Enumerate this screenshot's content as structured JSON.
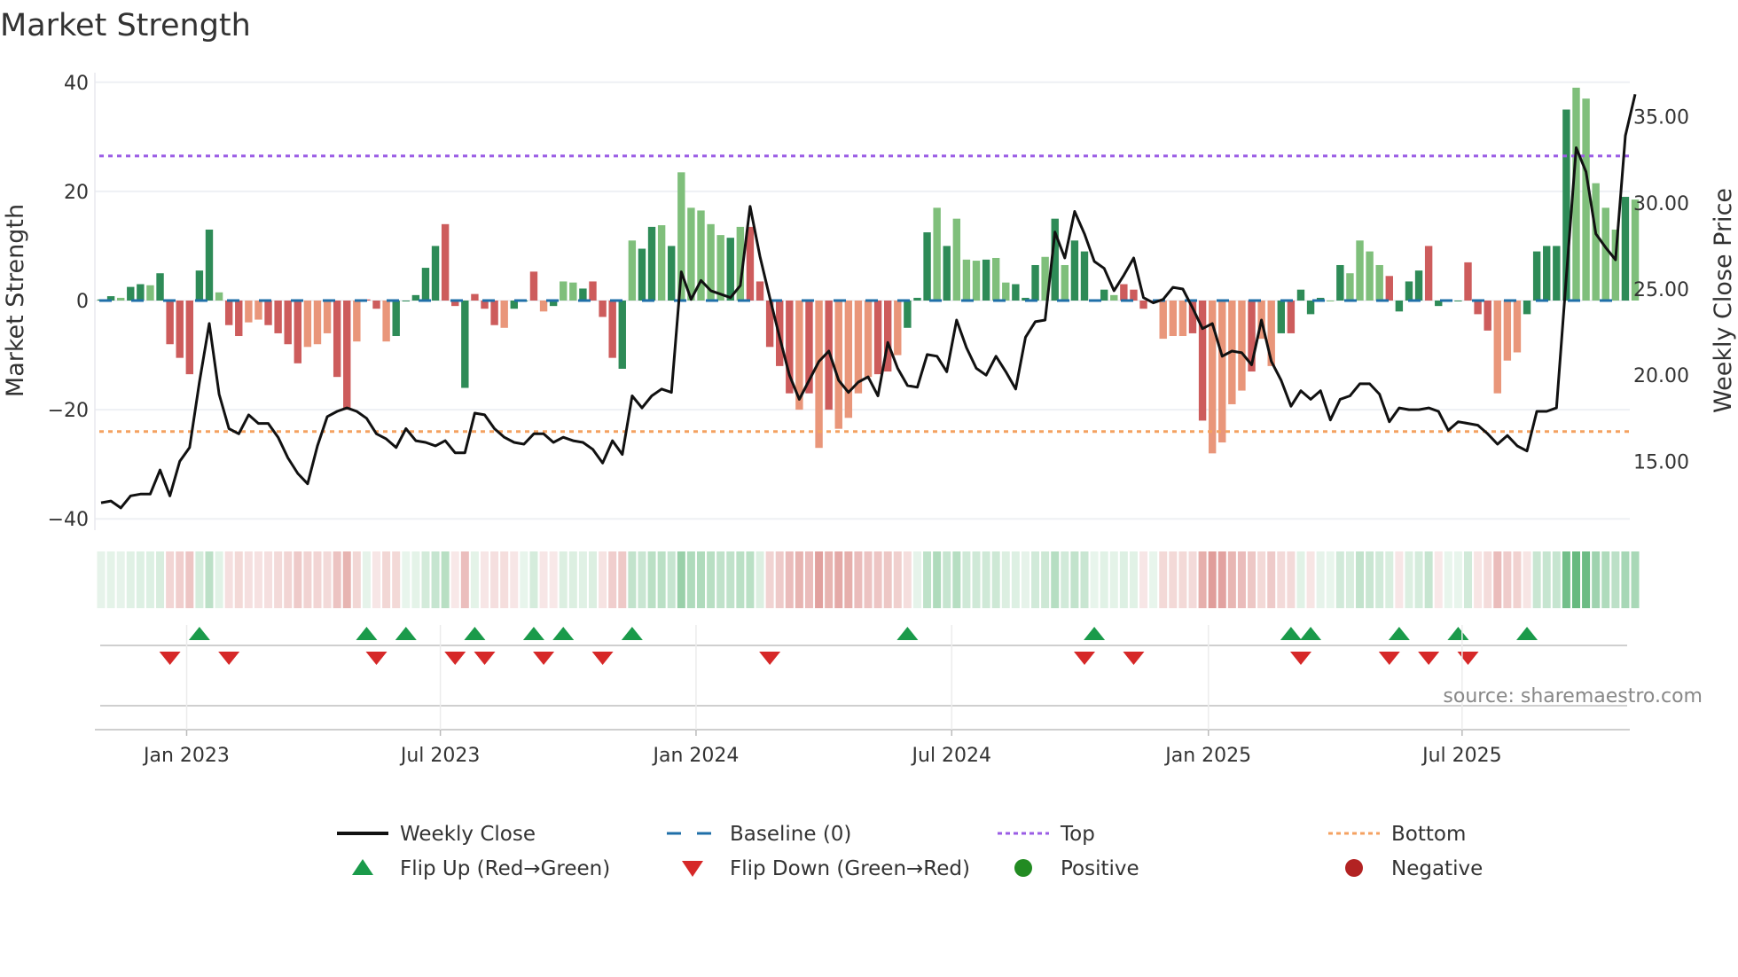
{
  "chart_data": {
    "type": "bar",
    "title": "Market Strength",
    "ylabel": "Market Strength",
    "y2label": "Weekly Close Price",
    "ylim": [
      -40,
      40
    ],
    "y2lim": [
      11.8,
      37.2
    ],
    "yticks": [
      40,
      20,
      0,
      -20,
      -40
    ],
    "yticklabels": [
      "40",
      "20",
      "0",
      "−20",
      "−40"
    ],
    "y2ticks": [
      35,
      30,
      25,
      20,
      15
    ],
    "y2ticklabels": [
      "35.00",
      "30.00",
      "25.00",
      "20.00",
      "15.00"
    ],
    "xticks": [
      {
        "label": "Jan 2023",
        "week": 8.7
      },
      {
        "label": "Jul 2023",
        "week": 34.5
      },
      {
        "label": "Jan 2024",
        "week": 60.5
      },
      {
        "label": "Jul 2024",
        "week": 86.5
      },
      {
        "label": "Jan 2025",
        "week": 112.6
      },
      {
        "label": "Jul 2025",
        "week": 138.4
      }
    ],
    "top_level": 26.5,
    "bottom_level": -24,
    "baseline": 0,
    "strength": [
      0.2,
      0.8,
      0.5,
      2.5,
      3,
      2.8,
      5,
      -8,
      -10.5,
      -13.5,
      5.5,
      13,
      1.5,
      -4.5,
      -6.5,
      -4,
      -3.5,
      -4.5,
      -6,
      -8,
      -11.5,
      -8.5,
      -8,
      -6,
      -14,
      -20,
      -7.5,
      0.2,
      -1.5,
      -7.5,
      -6.5,
      0,
      1,
      6,
      10,
      14,
      -1,
      -16,
      1.2,
      -1.5,
      -4.5,
      -5,
      -1.5,
      0,
      5.3,
      -2,
      -1,
      3.5,
      3.3,
      2.2,
      3.5,
      -3,
      -10.5,
      -12.5,
      11,
      9.5,
      13.5,
      13.8,
      10,
      23.5,
      17,
      16.5,
      14,
      12,
      11.5,
      13.5,
      13.5,
      3.5,
      -8.5,
      -12,
      -17,
      -20,
      -17,
      -27,
      -20,
      -23.5,
      -21.5,
      -17,
      -14,
      -13.5,
      -13,
      -10,
      -5,
      0.5,
      12.5,
      17,
      10,
      15,
      7.5,
      7.3,
      7.5,
      7.8,
      3.3,
      3,
      0.5,
      6.5,
      8,
      15,
      6.5,
      11,
      9,
      0,
      2,
      1,
      3,
      2,
      -1.5,
      0,
      -7,
      -6.5,
      -6.5,
      -6,
      -22,
      -28,
      -26,
      -19,
      -16.5,
      -13,
      -7,
      -12,
      -6,
      -6,
      2,
      -2.5,
      0.5,
      0,
      6.5,
      5,
      11,
      9,
      6.5,
      4.5,
      -2,
      3.5,
      5.5,
      10,
      -1,
      0,
      0,
      7,
      -2.5,
      -5.5,
      -17,
      -11,
      -9.5,
      -2.5,
      9,
      10,
      10,
      35,
      39,
      37,
      21.5,
      17,
      13,
      19,
      18.5
    ],
    "bar_shade": "GGgGGgGRRRGGgRRrrRRRRrrrRRrRRrGGGGGRRGRRRrGGRrGggGRRRGgGGgGgggggGgRRRRRrRrRrrrrRRrGGGgGgggGggGGGgGgGGgGgRRRRrrrRRrrrrRrrGRGGGgGggggRGGGRGGGRRRrrrGGGGGgggggGg",
    "weekly_close": [
      12.6,
      12.7,
      12.3,
      13.0,
      13.1,
      13.1,
      14.5,
      13.0,
      15.0,
      15.8,
      19.6,
      23.0,
      18.9,
      16.9,
      16.6,
      17.7,
      17.2,
      17.2,
      16.4,
      15.2,
      14.3,
      13.7,
      15.9,
      17.6,
      17.9,
      18.1,
      17.9,
      17.5,
      16.6,
      16.3,
      15.8,
      16.9,
      16.2,
      16.1,
      15.9,
      16.2,
      15.5,
      15.5,
      17.8,
      17.7,
      16.9,
      16.4,
      16.1,
      16.0,
      16.6,
      16.6,
      16.1,
      16.4,
      16.2,
      16.1,
      15.7,
      14.9,
      16.2,
      15.4,
      18.8,
      18.1,
      18.8,
      19.2,
      19.0,
      26.0,
      24.4,
      25.5,
      24.9,
      24.7,
      24.5,
      25.2,
      29.8,
      26.9,
      24.5,
      22.2,
      20.0,
      18.6,
      19.7,
      20.8,
      21.4,
      19.7,
      19.0,
      19.6,
      19.9,
      18.8,
      21.9,
      20.4,
      19.4,
      19.3,
      21.2,
      21.1,
      20.2,
      23.2,
      21.6,
      20.4,
      20.0,
      21.1,
      20.2,
      19.2,
      22.2,
      23.1,
      23.2,
      28.3,
      26.8,
      29.5,
      28.2,
      26.6,
      26.2,
      24.9,
      25.8,
      26.8,
      24.5,
      24.2,
      24.4,
      25.1,
      25.0,
      23.9,
      22.7,
      23.0,
      21.1,
      21.4,
      21.3,
      20.6,
      23.2,
      20.8,
      19.7,
      18.2,
      19.1,
      18.6,
      19.1,
      17.4,
      18.6,
      18.8,
      19.5,
      19.5,
      18.9,
      17.3,
      18.1,
      18.0,
      18.0,
      18.1,
      17.9,
      16.8,
      17.3,
      17.2,
      17.1,
      16.6,
      16.0,
      16.5,
      15.9,
      15.6,
      17.9,
      17.9,
      18.1,
      25.7,
      33.2,
      31.8,
      28.2,
      27.4,
      26.7,
      33.9,
      36.3
    ],
    "flip_up_weeks": [
      10,
      27,
      31,
      38,
      44,
      47,
      54,
      82,
      101,
      121,
      123,
      132,
      138,
      145
    ],
    "flip_down_weeks": [
      7,
      13,
      28,
      36,
      39,
      45,
      51,
      68,
      100,
      105,
      122,
      131,
      135,
      139
    ],
    "legend": [
      {
        "label": "Weekly Close",
        "symbol": "solid-line",
        "color": "#111111"
      },
      {
        "label": "Baseline (0)",
        "symbol": "dashed-line",
        "color": "#1f6fa8"
      },
      {
        "label": "Top",
        "symbol": "dotted-line",
        "color": "#9b5de5"
      },
      {
        "label": "Bottom",
        "symbol": "dotted-line",
        "color": "#f4a261"
      },
      {
        "label": "Flip Up (Red→Green)",
        "symbol": "triangle-up",
        "color": "#1a9a4a"
      },
      {
        "label": "Flip Down (Green→Red)",
        "symbol": "triangle-down",
        "color": "#d62828"
      },
      {
        "label": "Positive",
        "symbol": "circle",
        "color": "#228b22"
      },
      {
        "label": "Negative",
        "symbol": "circle",
        "color": "#b22222"
      }
    ],
    "legend_placement": "bottom",
    "grid": true,
    "colors": {
      "strong_pos": "#2e8b57",
      "weak_pos": "#7fbf7b",
      "strong_neg": "#cd5c5c",
      "weak_neg": "#e9967a"
    }
  },
  "source": "source: sharemaestro.com"
}
